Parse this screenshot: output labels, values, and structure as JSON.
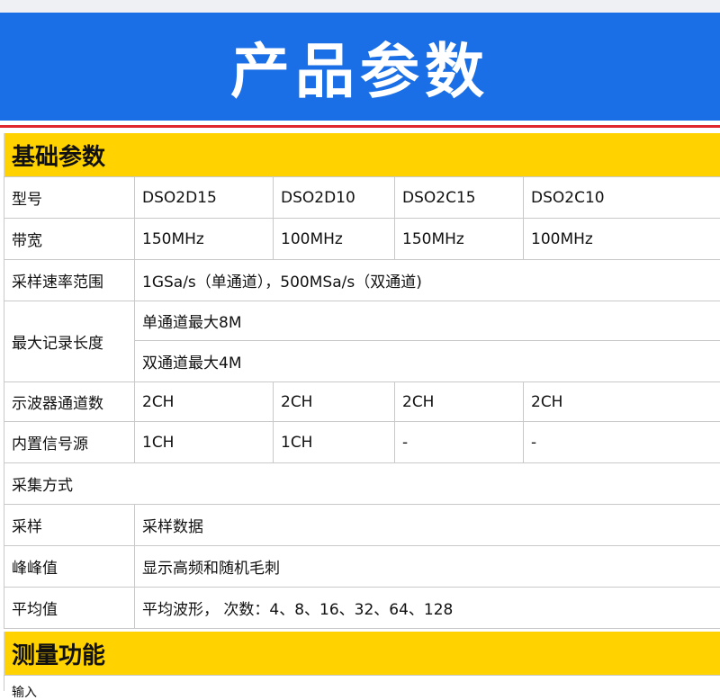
{
  "banner": {
    "title": "产品参数"
  },
  "sections": {
    "basic": "基础参数",
    "measure": "测量功能"
  },
  "rows": {
    "model": {
      "label": "型号",
      "values": [
        "DSO2D15",
        "DSO2D10",
        "DSO2C15",
        "DSO2C10"
      ]
    },
    "bandwidth": {
      "label": "带宽",
      "values": [
        "150MHz",
        "100MHz",
        "150MHz",
        "100MHz"
      ]
    },
    "sample_rate": {
      "label": "采样速率范围",
      "value": "1GSa/s（单通道），500MSa/s（双通道)"
    },
    "record_length": {
      "label": "最大记录长度",
      "values": [
        "单通道最大8M",
        "双通道最大4M"
      ]
    },
    "channels": {
      "label": "示波器通道数",
      "values": [
        "2CH",
        "2CH",
        "2CH",
        "2CH"
      ]
    },
    "signal_source": {
      "label": "内置信号源",
      "values": [
        "1CH",
        "1CH",
        "-",
        "-"
      ]
    },
    "acquisition": {
      "label": "采集方式"
    },
    "sampling": {
      "label": "采样",
      "value": "采样数据"
    },
    "peak": {
      "label": "峰峰值",
      "value": "显示高频和随机毛刺"
    },
    "average": {
      "label": "平均值",
      "value": "平均波形， 次数：4、8、16、32、64、128"
    }
  },
  "partial_row": {
    "label": "输入"
  }
}
